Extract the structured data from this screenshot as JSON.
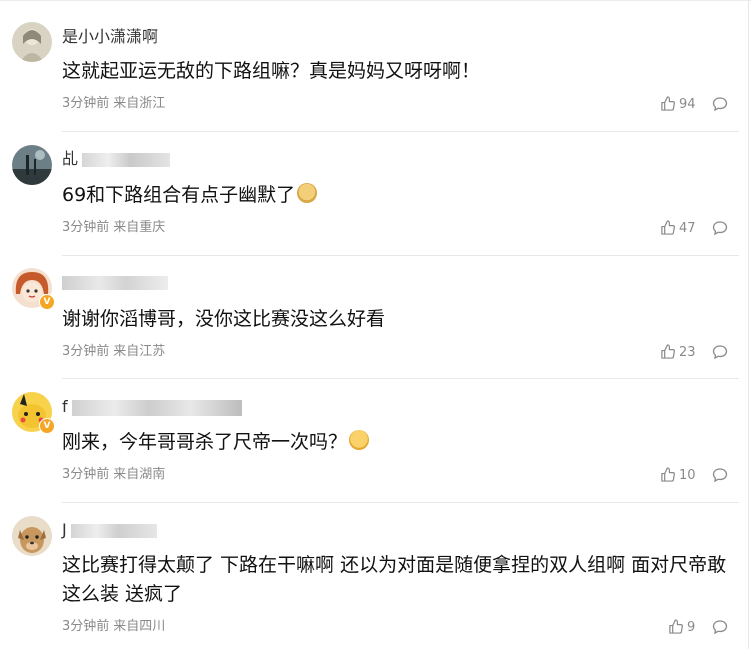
{
  "comments": [
    {
      "username": "是小小潇潇啊",
      "text": "这就起亚运无敌的下路组嘛？真是妈妈又呀呀啊！",
      "time": "3分钟前",
      "location": "来自浙江",
      "likes": "94",
      "avatar_icon": "girl-illustration-avatar",
      "verified": false
    },
    {
      "username": "乩",
      "text": "69和下路组合有点子幽默了",
      "time": "3分钟前",
      "location": "来自重庆",
      "likes": "47",
      "avatar_icon": "landscape-avatar",
      "verified": false,
      "emoji": "doge-emoji"
    },
    {
      "username": "",
      "text": "谢谢你滔博哥，没你这比赛没这么好看",
      "time": "3分钟前",
      "location": "来自江苏",
      "likes": "23",
      "avatar_icon": "anime-girl-avatar",
      "verified": true
    },
    {
      "username": "f",
      "text": "刚来，今年哥哥杀了尺帝一次吗？",
      "time": "3分钟前",
      "location": "来自湖南",
      "likes": "10",
      "avatar_icon": "pikachu-avatar",
      "verified": true,
      "emoji": "tongue-out-emoji"
    },
    {
      "username": "J",
      "text": "这比赛打得太颠了 下路在干嘛啊 还以为对面是随便拿捏的双人组啊 面对尺帝敢这么装 送疯了",
      "time": "3分钟前",
      "location": "来自四川",
      "likes": "9",
      "avatar_icon": "dog-avatar",
      "verified": false
    }
  ],
  "colors": {
    "meta_text": "#8a8a8a",
    "divider": "#e8e8e8",
    "badge": "#f5a623"
  },
  "icons": {
    "like": "thumbs-up-icon",
    "reply": "comment-bubble-icon"
  }
}
